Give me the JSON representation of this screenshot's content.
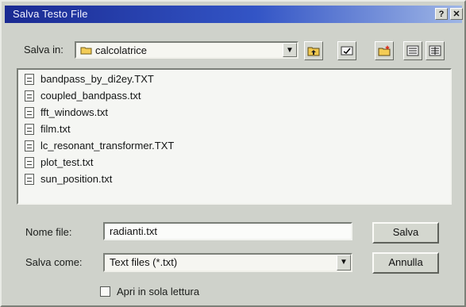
{
  "window": {
    "title": "Salva Testo File",
    "help_label": "?",
    "close_label": "✕"
  },
  "toolbar": {
    "save_in_label": "Salva in:",
    "current_folder": "calcolatrice",
    "dropdown_icon": "▼"
  },
  "files": [
    {
      "name": "bandpass_by_di2ey.TXT"
    },
    {
      "name": "coupled_bandpass.txt"
    },
    {
      "name": "fft_windows.txt"
    },
    {
      "name": "film.txt"
    },
    {
      "name": "lc_resonant_transformer.TXT"
    },
    {
      "name": "plot_test.txt"
    },
    {
      "name": "sun_position.txt"
    }
  ],
  "form": {
    "filename_label": "Nome file:",
    "filename_value": "radianti.txt",
    "savetype_label": "Salva come:",
    "savetype_value": "Text files (*.txt)",
    "readonly_label": "Apri in sola lettura",
    "save_button": "Salva",
    "cancel_button": "Annulla"
  }
}
